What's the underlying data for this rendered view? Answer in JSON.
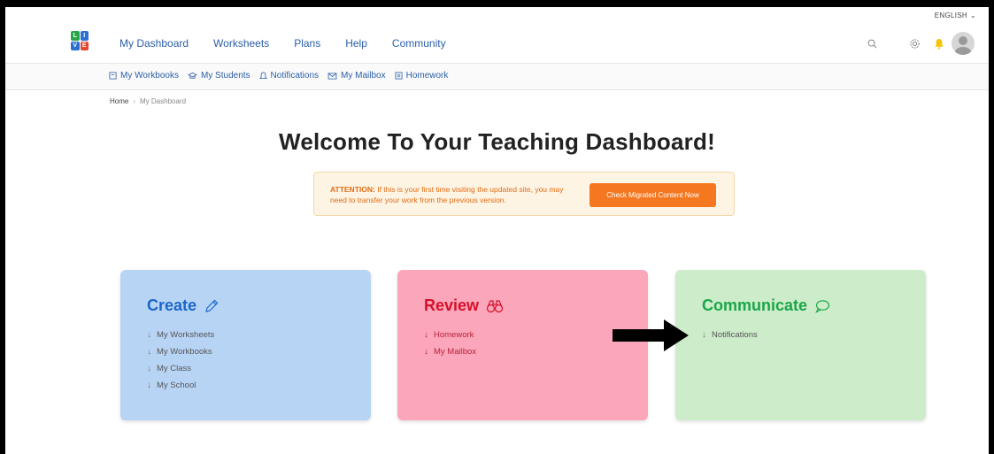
{
  "language": "ENGLISH",
  "logo": {
    "letters": [
      "L",
      "I",
      "V",
      "E"
    ],
    "colors": [
      "#27a64a",
      "#2d6fd0",
      "#2d6fd0",
      "#e3452f"
    ]
  },
  "nav": {
    "links": [
      "My Dashboard",
      "Worksheets",
      "Plans",
      "Help",
      "Community"
    ]
  },
  "subnav": {
    "items": [
      {
        "label": "My Workbooks",
        "icon": "workbook-icon"
      },
      {
        "label": "My Students",
        "icon": "students-icon"
      },
      {
        "label": "Notifications",
        "icon": "bell-outline-icon"
      },
      {
        "label": "My Mailbox",
        "icon": "mail-icon"
      },
      {
        "label": "Homework",
        "icon": "homework-icon"
      }
    ]
  },
  "breadcrumb": {
    "home": "Home",
    "separator": "›",
    "current": "My Dashboard"
  },
  "page_title": "Welcome To Your Teaching Dashboard!",
  "attention": {
    "label": "ATTENTION:",
    "message": "If this is your first time visiting the updated site, you may need to transfer your work from the previous version.",
    "button": "Check Migrated Content Now"
  },
  "cards": {
    "create": {
      "title": "Create",
      "items": [
        "My Worksheets",
        "My Workbooks",
        "My Class",
        "My School"
      ]
    },
    "review": {
      "title": "Review",
      "items": [
        "Homework",
        "My Mailbox"
      ]
    },
    "communicate": {
      "title": "Communicate",
      "items": [
        "Notifications"
      ]
    }
  },
  "colors": {
    "nav_link": "#2b5fa8",
    "accent_orange": "#f57820",
    "bell": "#f5c400",
    "create_bg": "#b8d4f5",
    "review_bg": "#fba6ba",
    "communicate_bg": "#cdecca"
  }
}
